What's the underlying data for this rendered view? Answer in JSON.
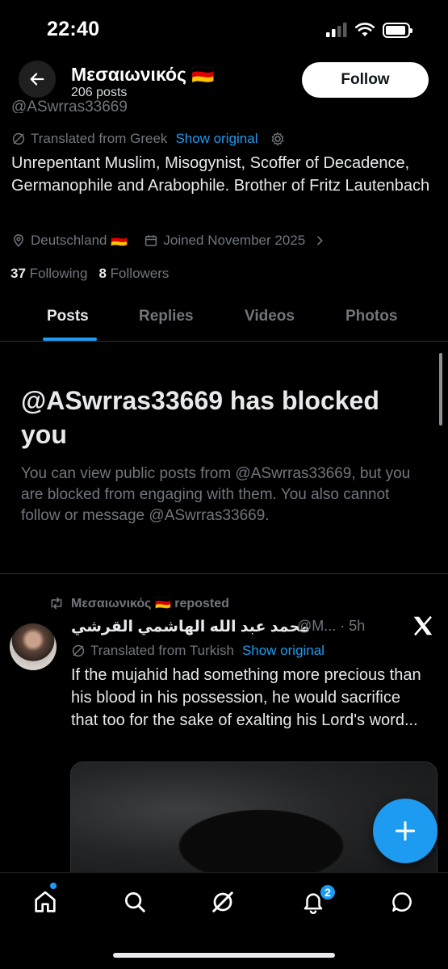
{
  "status_bar": {
    "time": "22:40"
  },
  "header": {
    "display_name": "Μεσαιωνικός 🇩🇪",
    "posts_count": "206 posts",
    "follow_label": "Follow",
    "handle_partial": "@ASwrras33669"
  },
  "profile": {
    "translated_label": "Translated from Greek",
    "show_original": "Show original",
    "bio": "Unrepentant Muslim, Misogynist, Scoffer of Decadence, Germanophile and Arabophile. Brother of Fritz Lautenbach",
    "location": "Deutschland 🇩🇪",
    "joined": "Joined November 2025",
    "following_count": "37",
    "following_label": "Following",
    "followers_count": "8",
    "followers_label": "Followers"
  },
  "tabs": [
    {
      "label": "Posts"
    },
    {
      "label": "Replies"
    },
    {
      "label": "Videos"
    },
    {
      "label": "Photos"
    }
  ],
  "blocked": {
    "title": "@ASwrras33669 has blocked you",
    "message": "You can view public posts from @ASwrras33669, but you are blocked from engaging with them. You also cannot follow or message @ASwrras33669."
  },
  "tweet": {
    "reposted_label": "Μεσαιωνικός 🇩🇪 reposted",
    "author_name": "محمد عبد الله الهاشمي القرشي",
    "author_handle_time": "@M... · 5h",
    "translated_label": "Translated from Turkish",
    "show_original": "Show original",
    "text": "If the mujahid had something more precious than his blood in his possession, he would sacrifice that too for the sake of exalting his Lord's word..."
  },
  "bottom_nav": {
    "notifications_badge": "2"
  },
  "colors": {
    "accent": "#1d9bf0",
    "background": "#000000",
    "muted_text": "#71767b"
  }
}
